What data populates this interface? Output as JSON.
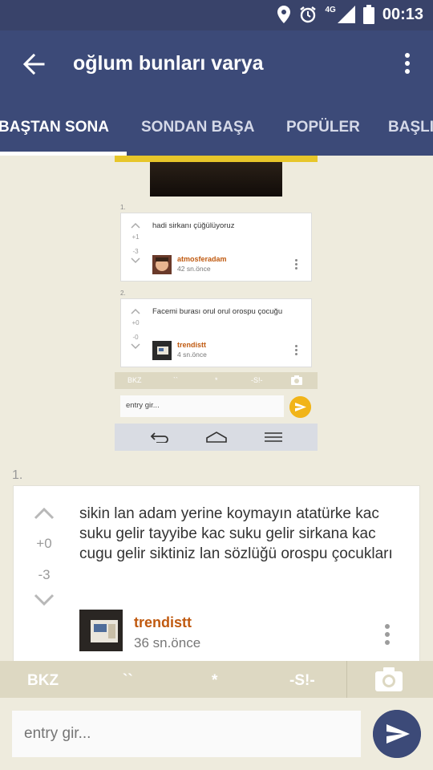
{
  "status_bar": {
    "network": "4G",
    "time": "00:13"
  },
  "app_bar": {
    "title": "oğlum bunları varya"
  },
  "tabs": [
    {
      "label": "BAŞTAN SONA",
      "active": true
    },
    {
      "label": "SONDAN BAŞA",
      "active": false
    },
    {
      "label": "POPÜLER",
      "active": false
    },
    {
      "label": "BAŞLI",
      "active": false
    }
  ],
  "embedded_screenshot": {
    "entries": [
      {
        "number": "1.",
        "text": "hadi sirkanı çüğülüyoruz",
        "up": "+1",
        "down": "-3",
        "author": "atmosferadam",
        "time": "42 sn.önce"
      },
      {
        "number": "2.",
        "text": "Facemi burası orul orul orospu çocuğu",
        "up": "+0",
        "down": "-0",
        "author": "trendistt",
        "time": "4 sn.önce"
      }
    ],
    "toolbar": {
      "bkz": "BKZ",
      "backticks": "``",
      "star": "*",
      "s": "-S!-"
    },
    "input_placeholder": "entry gir..."
  },
  "entry": {
    "number": "1.",
    "text": "sikin lan adam yerine koymayın atatürke kac suku gelir tayyibe kac suku gelir sirkana kac cugu gelir siktiniz lan sözlüğü orospu çocukları",
    "vote_up": "+0",
    "vote_down": "-3",
    "author": "trendistt",
    "time": "36 sn.önce"
  },
  "toolbar": {
    "bkz": "BKZ",
    "backticks": "``",
    "star": "*",
    "s": "-S!-"
  },
  "input": {
    "placeholder": "entry gir..."
  },
  "colors": {
    "primary": "#3c4a78",
    "author": "#c05a10",
    "background": "#eeebdd",
    "toolbar": "#ddd8c2"
  }
}
